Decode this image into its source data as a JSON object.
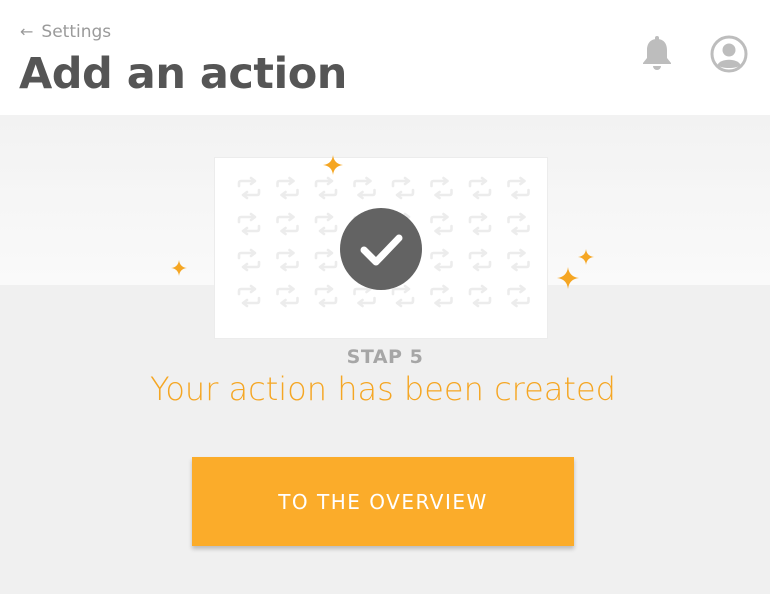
{
  "header": {
    "back_arrow": "←",
    "back_label": "Settings",
    "title": "Add an action"
  },
  "icons": {
    "notifications": "bell-icon",
    "profile": "user-icon",
    "confirmation": "checkmark-icon",
    "pattern": "repeat-icon",
    "decoration": "sparkle-icon"
  },
  "step": {
    "label": "STAP 5",
    "message": "Your action has been created"
  },
  "actions": {
    "overview_label": "TO THE OVERVIEW"
  },
  "colors": {
    "accent": "#fbac2a",
    "message": "#f5a623",
    "sparkle": "#f5a623",
    "title": "#555555",
    "icon": "#bdbdbd",
    "check_circle": "#636363"
  }
}
